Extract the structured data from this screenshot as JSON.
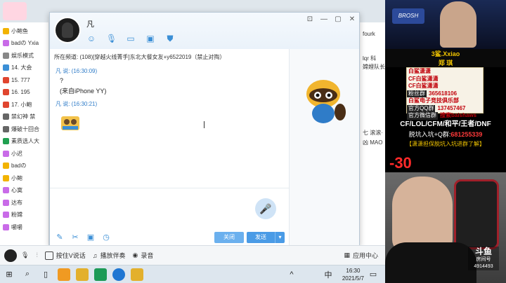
{
  "bg_app": {
    "left_rows": [
      {
        "text": "小鲍鱼",
        "color": "#f2b300"
      },
      {
        "text": "badの Yxia",
        "color": "#c96be8"
      },
      {
        "text": "娱乐模式",
        "color": "#888888"
      },
      {
        "text": "14. 大会",
        "color": "#3b8fd6"
      },
      {
        "text": "15. 777",
        "color": "#e0452f"
      },
      {
        "text": "16. 195",
        "color": "#e0452f"
      },
      {
        "text": "17. 小鲍",
        "color": "#e0452f"
      },
      {
        "text": "禁幻神 禁",
        "color": "#666666"
      },
      {
        "text": "爆破十回合",
        "color": "#666666"
      },
      {
        "text": "素质选人大",
        "color": "#20a050"
      },
      {
        "text": "小迟",
        "color": "#c96be8"
      },
      {
        "text": "badの",
        "color": "#f2b300"
      },
      {
        "text": "小鲍",
        "color": "#f2b300"
      },
      {
        "text": "心寞",
        "color": "#c96be8"
      },
      {
        "text": "达布",
        "color": "#c96be8"
      },
      {
        "text": "粉嫦",
        "color": "#c96be8"
      },
      {
        "text": "嚼嚼",
        "color": "#c96be8"
      }
    ],
    "right_texts": [
      "fourk",
      "lqr 科",
      "嫦娌队长",
      "七 滚滚·",
      "凶 MAO"
    ]
  },
  "chat": {
    "contact_name": "凡",
    "notice": "所在频道: (108)[穿越火线菁手]东北大餐女友+y6522019（禁止对掏）",
    "messages": [
      {
        "meta": "凡 说: (16:30:09)",
        "lines": [
          "?",
          "(来自iPhone YY)"
        ]
      },
      {
        "meta": "凡 说: (16:30:21)",
        "lines": []
      }
    ],
    "buttons": {
      "close": "关闭",
      "send": "发送",
      "dropdown": "▾"
    },
    "window_controls": [
      "⊡",
      "—",
      "▢",
      "✕"
    ]
  },
  "toolbar": {
    "items": [
      {
        "icon": "mic-icon",
        "label": ""
      },
      {
        "icon": "equalizer-icon",
        "label": ""
      },
      {
        "icon": "checkbox-icon",
        "label": "按住V说话"
      },
      {
        "icon": "music-icon",
        "label": "播放伴奏"
      },
      {
        "icon": "record-icon",
        "label": "录音"
      }
    ],
    "app_center": "应用中心"
  },
  "taskbar": {
    "time": "16:30",
    "date": "2021/5/7",
    "ime": "中"
  },
  "stream": {
    "brand": "BROSH",
    "tag": "3鲨.Xxiao",
    "subname": "郑 琪",
    "info": [
      {
        "key": "",
        "value": "白鲨潇潇"
      },
      {
        "key": "",
        "value": "CF白鲨潇潇"
      },
      {
        "key": "",
        "value": "CF白鲨潇潇"
      },
      {
        "key": "粉丝群",
        "value": "365618106"
      },
      {
        "key": "",
        "value": "白鲨电子竞技俱乐部"
      },
      {
        "key": "官方QQ群",
        "value": "137457467"
      },
      {
        "key": "官方微信群",
        "value": "搜索baishaws"
      }
    ],
    "games": "CF/LOL/CFM/和平/王者/DNF",
    "promo_prefix": "脱坑入坑+Q群:",
    "promo_number": "681255339",
    "guarantee": "【潇潇担保脱坑入坑进群了解】",
    "score": "-30",
    "watermark_title": "斗鱼",
    "watermark_sub": "房间号",
    "room_id": "4914493"
  }
}
